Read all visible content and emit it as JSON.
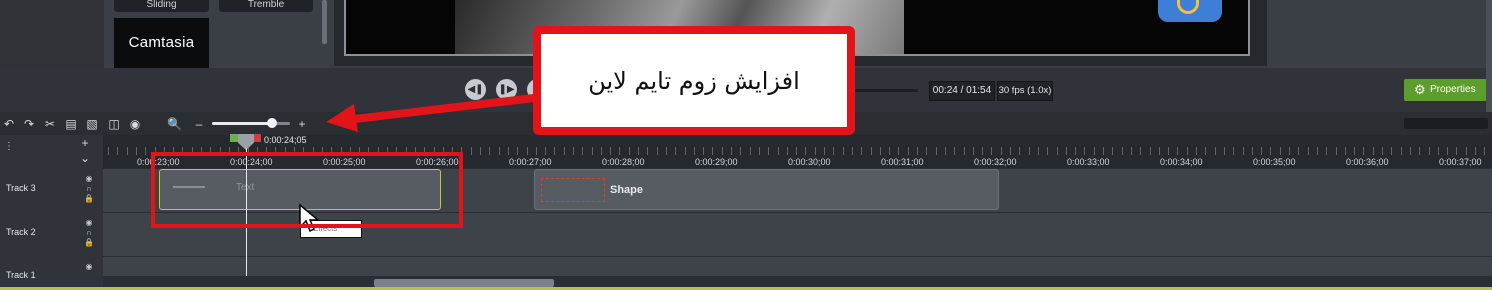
{
  "media_bin": {
    "transitions": [
      "Sliding",
      "Tremble"
    ],
    "library_item": "Camtasia"
  },
  "playback": {
    "time_display": "00:24 / 01:54",
    "fps_display": "30 fps (1.0x)",
    "properties_label": "Properties"
  },
  "timeline": {
    "playhead_time": "0:00:24;05",
    "ruler_labels": [
      "0:00:23;00",
      "0:00:24;00",
      "0:00:25;00",
      "0:00:26;00",
      "0:00:27;00",
      "0:00:28;00",
      "0:00:29;00",
      "0:00:30;00",
      "0:00:31;00",
      "0:00:32;00",
      "0:00:33;00",
      "0:00:34;00",
      "0:00:35;00",
      "0:00:36;00",
      "0:00:37;00"
    ],
    "tracks": [
      {
        "label": "Track 3"
      },
      {
        "label": "Track 2"
      },
      {
        "label": "Track 1"
      }
    ],
    "clips": {
      "text_clip_label": "Text",
      "shape_clip_label": "Shape"
    },
    "tooltip": "Effects"
  },
  "annotation": {
    "callout_text": "افزایش زوم تایم لاین",
    "accent_color": "#e2141a"
  },
  "colors": {
    "properties_green": "#5c9e2a",
    "selected_clip_border": "#c9c43a",
    "playhead_green": "#6bb14a",
    "playhead_red": "#c9403c"
  },
  "icons": {
    "toolbar": [
      "undo-icon",
      "redo-icon",
      "cut-icon",
      "copy-icon",
      "paste-icon",
      "split-icon",
      "snapshot-icon",
      "zoom-search-icon",
      "zoom-out-icon",
      "zoom-in-icon"
    ],
    "playback": [
      "step-back-icon",
      "play-icon",
      "gear-icon"
    ]
  }
}
